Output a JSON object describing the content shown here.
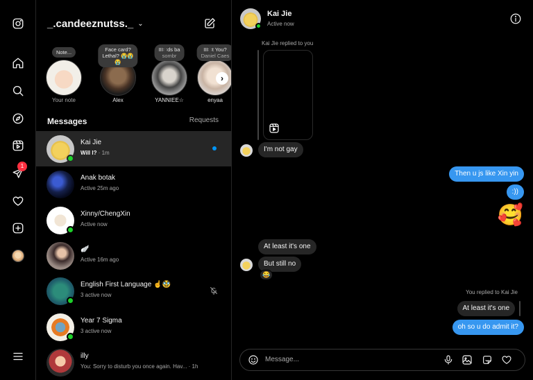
{
  "nav": {
    "badge_count": "1"
  },
  "sidebar": {
    "account_name": "_.candeeznutss._",
    "notes": [
      {
        "text": "Note...",
        "sub": "",
        "name": "Your note"
      },
      {
        "text": "Face card?",
        "sub": "Lethal? 😭😭",
        "sub2": "😭",
        "name": "Alex"
      },
      {
        "text": "III꞉ ꞉ds ba",
        "sub": "sombr",
        "name": "YANNIEE☆"
      },
      {
        "text": "III꞉ ꞉t You?",
        "sub": "Daniel Caes",
        "name": "enyaa"
      }
    ],
    "messages_heading": "Messages",
    "requests_label": "Requests",
    "conversations": [
      {
        "name": "Kai Jie",
        "bold_preview": "Will I?",
        "meta": " · 1m",
        "status": ""
      },
      {
        "name": "Anak botak",
        "bold_preview": "",
        "meta": "",
        "status": "Active 25m ago"
      },
      {
        "name": "Xinny/ChengXin",
        "bold_preview": "",
        "meta": "",
        "status": "Active now"
      },
      {
        "name": "🪽",
        "bold_preview": "",
        "meta": "",
        "status": "Active 16m ago"
      },
      {
        "name": "English First Language ☝️🥸",
        "bold_preview": "",
        "meta": "",
        "status": "3 active now"
      },
      {
        "name": "Year 7 Sigma",
        "bold_preview": "",
        "meta": "",
        "status": "3 active now"
      },
      {
        "name": "illy",
        "bold_preview": "",
        "meta": "",
        "status": "You: Sorry to disturb you once again. Hav... · 1h"
      }
    ]
  },
  "chat": {
    "name": "Kai Jie",
    "status": "Active now",
    "reply_label_in": "Kai Jie replied to you",
    "reply_label_out": "You replied to Kai Jie",
    "messages": {
      "m1": "I'm not gay",
      "m2": "Then u js like Xin yin",
      "m3": ":))",
      "m4": "🥰",
      "m5": "At least it's one",
      "m6": "But still no",
      "m6_reaction": "😂",
      "m7_quote": "At least it's one",
      "m8": "oh so u do admit it?"
    },
    "composer_placeholder": "Message..."
  }
}
